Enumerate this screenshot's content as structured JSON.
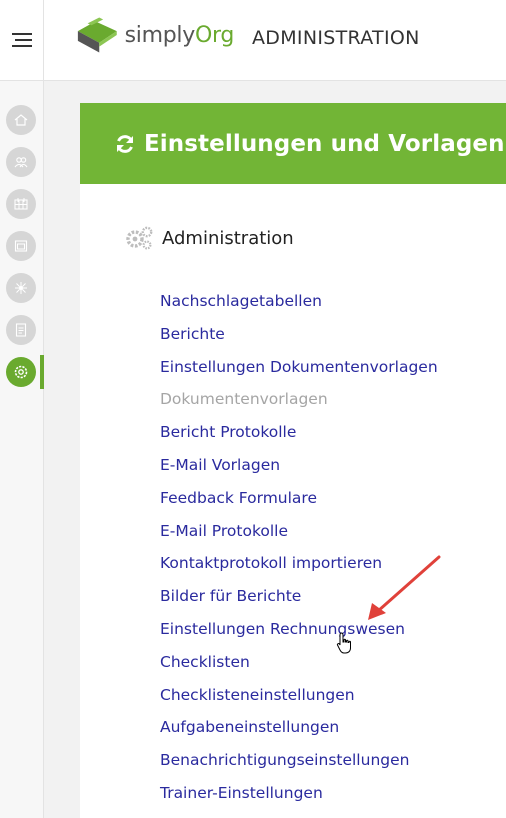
{
  "header": {
    "logo": {
      "text_simply": "simply",
      "text_org": "Org",
      "icon": "simplyorg-logo-icon"
    },
    "section_title": "ADMINISTRATION",
    "menu_icon": "hamburger-icon"
  },
  "rail": {
    "items": [
      {
        "icon": "home-icon",
        "active": false
      },
      {
        "icon": "users-icon",
        "active": false
      },
      {
        "icon": "calendar-grid-icon",
        "active": false
      },
      {
        "icon": "window-icon",
        "active": false
      },
      {
        "icon": "network-icon",
        "active": false
      },
      {
        "icon": "checklist-icon",
        "active": false
      },
      {
        "icon": "gear-icon",
        "active": true
      }
    ]
  },
  "banner": {
    "icon": "refresh-icon",
    "title": "Einstellungen und Vorlagen"
  },
  "admin": {
    "icon": "gears-icon",
    "title": "Administration",
    "links": [
      {
        "label": "Nachschlagetabellen",
        "enabled": true
      },
      {
        "label": "Berichte",
        "enabled": true
      },
      {
        "label": "Einstellungen Dokumentenvorlagen",
        "enabled": true
      },
      {
        "label": "Dokumentenvorlagen",
        "enabled": false
      },
      {
        "label": "Bericht Protokolle",
        "enabled": true
      },
      {
        "label": "E-Mail Vorlagen",
        "enabled": true
      },
      {
        "label": "Feedback Formulare",
        "enabled": true
      },
      {
        "label": "E-Mail Protokolle",
        "enabled": true
      },
      {
        "label": "Kontaktprotokoll importieren",
        "enabled": true
      },
      {
        "label": "Bilder für Berichte",
        "enabled": true
      },
      {
        "label": "Einstellungen Rechnungswesen",
        "enabled": true
      },
      {
        "label": "Checklisten",
        "enabled": true
      },
      {
        "label": "Checklisteneinstellungen",
        "enabled": true
      },
      {
        "label": "Aufgabeneinstellungen",
        "enabled": true
      },
      {
        "label": "Benachrichtigungseinstellungen",
        "enabled": true
      },
      {
        "label": "Trainer-Einstellungen",
        "enabled": true
      }
    ]
  },
  "colors": {
    "brand_green": "#72b536",
    "link_blue": "#2a2a9e",
    "disabled_gray": "#a5a5a5",
    "annotation_red": "#e0413a"
  }
}
